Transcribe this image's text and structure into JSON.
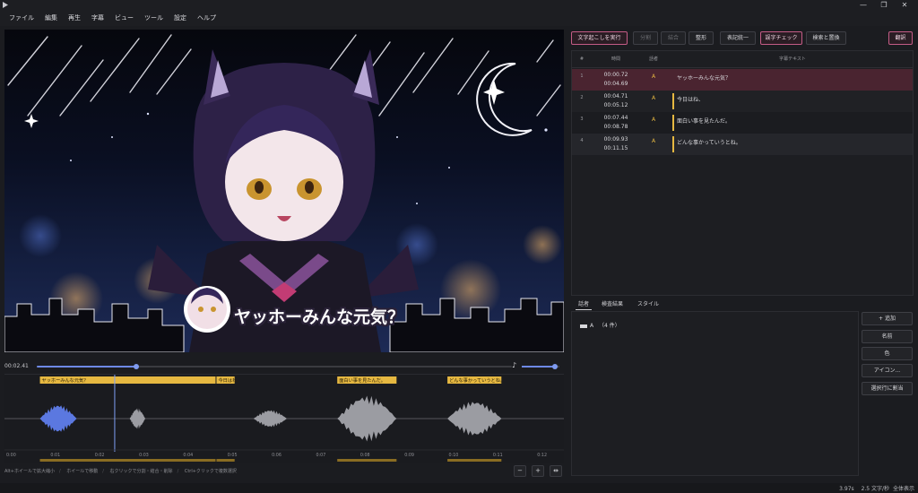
{
  "window": {
    "minimize": "—",
    "maximize": "❐",
    "close": "✕"
  },
  "menu": [
    "ファイル",
    "編集",
    "再生",
    "字幕",
    "ビュー",
    "ツール",
    "設定",
    "ヘルプ"
  ],
  "video": {
    "caption": "ヤッホーみんな元気？",
    "character_icon": "catgirl-avatar-icon"
  },
  "playback": {
    "current_time": "00:02.41",
    "seek_progress": 0.21,
    "volume": 0.88,
    "volume_icon": "♪"
  },
  "timeline": {
    "ruler": [
      "0:00",
      "0:01",
      "0:02",
      "0:03",
      "0:04",
      "0:05",
      "0:06",
      "0:07",
      "0:08",
      "0:09",
      "0:10",
      "0:11",
      "0:12"
    ],
    "clips": [
      {
        "label": "ヤッホーみんな元気？",
        "start": 0.72,
        "end": 4.69
      },
      {
        "label": "今日はね、",
        "start": 4.71,
        "end": 5.12
      },
      {
        "label": "面白い事を見たんだ。",
        "start": 7.44,
        "end": 8.78
      },
      {
        "label": "どんな事かっていうとね。",
        "start": 9.93,
        "end": 11.15
      }
    ],
    "playhead": 2.41,
    "duration": 12.4,
    "colors": {
      "clip": "#e6b841",
      "wave_active": "#5b78e0",
      "wave": "#9b9ca2"
    }
  },
  "hints": [
    "Alt+ホイールで拡大縮小",
    "ホイールで移動",
    "右クリックで分割・結合・削除",
    "Ctrl+クリックで複数選択"
  ],
  "zoom_buttons": {
    "zoom_out": "−",
    "zoom_in": "+",
    "fit": "⇹"
  },
  "toolbar": {
    "transcribe": "文字起こしを実行",
    "split": "分割",
    "merge": "結合",
    "format": "整形",
    "unify": "表記統一",
    "typo_check": "誤字チェック",
    "find_replace": "検索と置換",
    "translate": "翻訳"
  },
  "subtitle_table": {
    "headers": {
      "time": "時間",
      "speaker": "話者",
      "text": "字幕テキスト"
    },
    "rows": [
      {
        "no": "1",
        "start": "00:00.72",
        "end": "00:04.69",
        "speaker": "A",
        "text": "ヤッホーみんな元気？"
      },
      {
        "no": "2",
        "start": "00:04.71",
        "end": "00:05.12",
        "speaker": "A",
        "text": "今日はね、"
      },
      {
        "no": "3",
        "start": "00:07.44",
        "end": "00:08.78",
        "speaker": "A",
        "text": "面白い事を見たんだ。"
      },
      {
        "no": "4",
        "start": "00:09.93",
        "end": "00:11.15",
        "speaker": "A",
        "text": "どんな事かっていうとね。"
      }
    ]
  },
  "lower_tabs": [
    "話者",
    "検査結果",
    "スタイル"
  ],
  "speaker_panel": {
    "speaker_name": "A",
    "count": "（4 件）"
  },
  "speaker_buttons": {
    "add": "+ 追加",
    "name": "名前",
    "color": "色",
    "icon": "アイコン...",
    "assign": "選択行に割当"
  },
  "status": {
    "duration": "3.97s",
    "rate": "2.5 文字/秒",
    "mode": "全体表示"
  }
}
